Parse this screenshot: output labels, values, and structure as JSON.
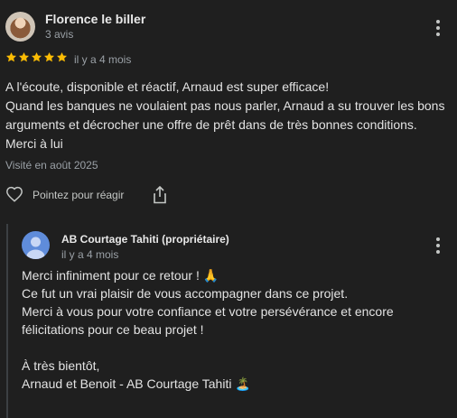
{
  "review": {
    "author_name": "Florence le biller",
    "author_review_count": "3 avis",
    "rating": 5,
    "rating_max": 5,
    "time_ago": "il y a 4 mois",
    "text_lines": [
      "A l'écoute, disponible et réactif, Arnaud est super efficace!",
      "Quand les banques ne voulaient pas nous parler, Arnaud a su trouver les bons",
      "arguments et décrocher une offre de prêt dans de très bonnes conditions.",
      "Merci à lui"
    ],
    "visited": "Visité en août 2025",
    "react_label": "Pointez pour réagir"
  },
  "reply": {
    "owner_name": "AB Courtage Tahiti (propriétaire)",
    "time_ago": "il y a 4 mois",
    "text_lines": [
      "Merci infiniment pour ce retour ! 🙏",
      "Ce fut un vrai plaisir de vous accompagner dans ce projet.",
      "Merci à vous pour votre confiance et votre persévérance et encore",
      "félicitations pour ce beau projet !",
      "",
      "À très bientôt,",
      "Arnaud et Benoit - AB Courtage Tahiti 🏝️"
    ]
  },
  "icons": {
    "star": "star-icon",
    "heart": "heart-outline-icon",
    "share": "share-icon",
    "more": "more-vert-icon",
    "avatar_default": "person-icon"
  },
  "colors": {
    "background": "#1f1f1f",
    "star": "#fbbc04",
    "owner_avatar": "#5f8cda",
    "secondary_text": "#9aa0a6"
  }
}
